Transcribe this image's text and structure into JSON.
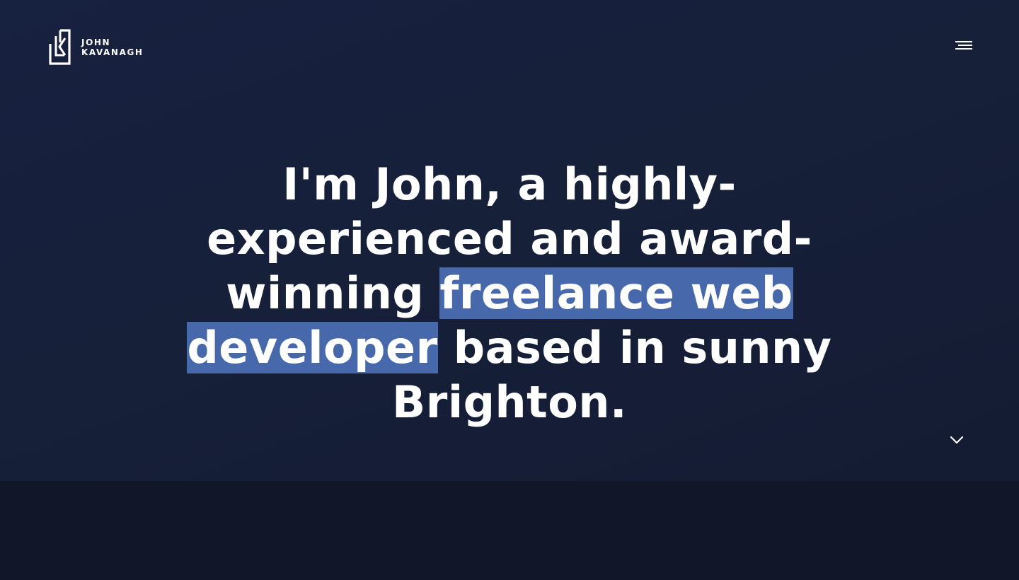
{
  "brand": {
    "first_name": "JOHN",
    "last_name": "KAVANAGH",
    "logo_icon": "jk-monogram-icon"
  },
  "nav": {
    "menu_icon": "hamburger-menu-icon"
  },
  "hero": {
    "intro": "I'm John, a highly-experienced and award-winning",
    "highlight": "freelance web developer",
    "outro": "based in sunny Brighton.",
    "scroll_icon": "chevron-down-icon"
  },
  "colors": {
    "hero_background": "#172140",
    "page_background": "#111729",
    "highlight": "#4768ab",
    "text": "#ffffff"
  }
}
